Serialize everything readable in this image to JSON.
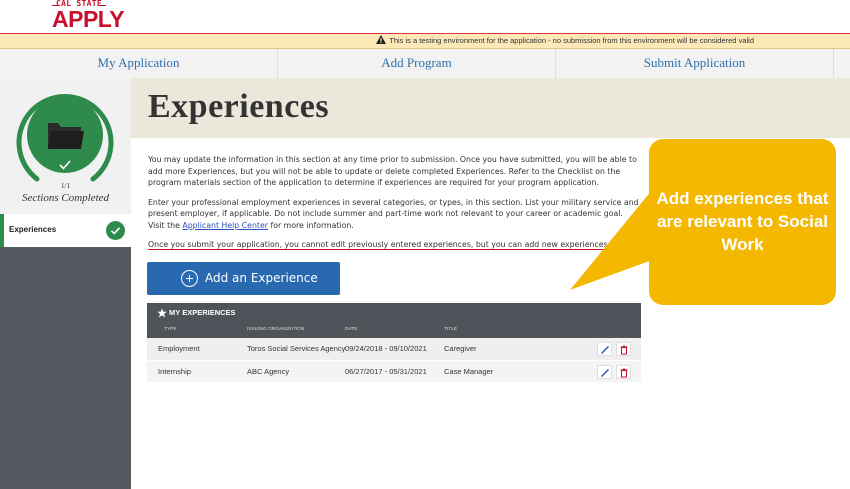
{
  "header": {
    "logo_top": "CAL STATE",
    "logo_main": "APPLY",
    "banner_text": "This is a testing environment for the application - no submission from this environment will be considered valid"
  },
  "nav": {
    "tabs": [
      {
        "label": "My Application"
      },
      {
        "label": "Add Program"
      },
      {
        "label": "Submit Application"
      }
    ]
  },
  "sidebar": {
    "progress_fraction": "1/1",
    "progress_value": 1.0,
    "sections_label": "Sections Completed",
    "items": [
      {
        "label": "Experiences",
        "status": "complete"
      }
    ]
  },
  "main": {
    "title": "Experiences",
    "para1": "You may update the information in this section at any time prior to submission. Once you have submitted, you will be able to add more Experiences, but you will not be able to update or delete completed Experiences. Refer to the Checklist on the program materials section of the application to determine if experiences are required for your program application.",
    "para2_before": "Enter your professional employment experiences in several categories, or types, in this section. List your military service and present employer, if applicable. Do not include summer and part-time work not relevant to your career or academic goal. Visit the ",
    "para2_link": "Applicant Help Center",
    "para2_after": " for more information.",
    "para3": "Once you submit your application, you cannot edit previously entered experiences, but you can add new experiences.",
    "add_button_label": "Add an Experience"
  },
  "experiences": {
    "section_title": "MY EXPERIENCES",
    "columns": [
      "TYPE",
      "ISSUING ORGANIZATION",
      "DATE",
      "TITLE"
    ],
    "rows": [
      {
        "type": "Employment",
        "organization": "Toros Social Services Agency",
        "date": "09/24/2018 - 09/10/2021",
        "title": "Caregiver"
      },
      {
        "type": "Internship",
        "organization": "ABC Agency",
        "date": "06/27/2017 - 05/31/2021",
        "title": "Case Manager"
      }
    ]
  },
  "callout": {
    "text": "Add experiences that are relevant to Social Work"
  },
  "colors": {
    "brand_red": "#c8102e",
    "link_blue": "#2f6fab",
    "button_blue": "#2969b0",
    "success_green": "#2f8b4c",
    "callout_yellow": "#f5b800",
    "sidebar_dark": "#555a60"
  }
}
